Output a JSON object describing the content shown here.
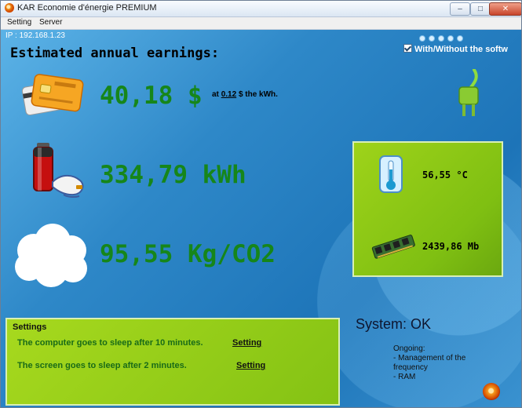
{
  "window": {
    "title": "KAR Economie d'énergie PREMIUM",
    "buttons": {
      "minimize": "–",
      "maximize": "□",
      "close": "✕"
    }
  },
  "menu": {
    "items": [
      "Setting",
      "Server"
    ]
  },
  "status": {
    "ip": "IP : 192.168.1.23",
    "toggle_label": "With/Without the softw",
    "toggle_checked": true
  },
  "earnings": {
    "title": "Estimated annual earnings:",
    "money": "40,18 $",
    "rate_prefix": "at",
    "rate_value": "0.12",
    "rate_suffix": "$ the kWh.",
    "energy": "334,79 kWh",
    "co2": "95,55 Kg/CO2"
  },
  "system_panel": {
    "temperature": "56,55 °C",
    "memory": "2439,86 Mb"
  },
  "settings": {
    "title": "Settings",
    "computer_sleep": "The computer goes to sleep after 10 minutes.",
    "screen_sleep": "The screen goes to sleep after 2 minutes.",
    "link_label": "Setting"
  },
  "system_status": {
    "label": "System: OK",
    "ongoing_title": "Ongoing:",
    "ongoing_item_1": "- Management of the",
    "ongoing_item_1_cont": "frequency",
    "ongoing_item_2": "- RAM"
  },
  "colors": {
    "background": "#2f7fb8",
    "green_panel": "#8fcb18",
    "stat_text": "#16861a"
  },
  "icons": [
    "app-icon",
    "minimize-icon",
    "maximize-icon",
    "close-icon",
    "credit-card-icon",
    "battery-plug-icon",
    "cloud-icon",
    "power-plug-icon",
    "thermometer-icon",
    "ram-icon",
    "app-logo-icon"
  ]
}
